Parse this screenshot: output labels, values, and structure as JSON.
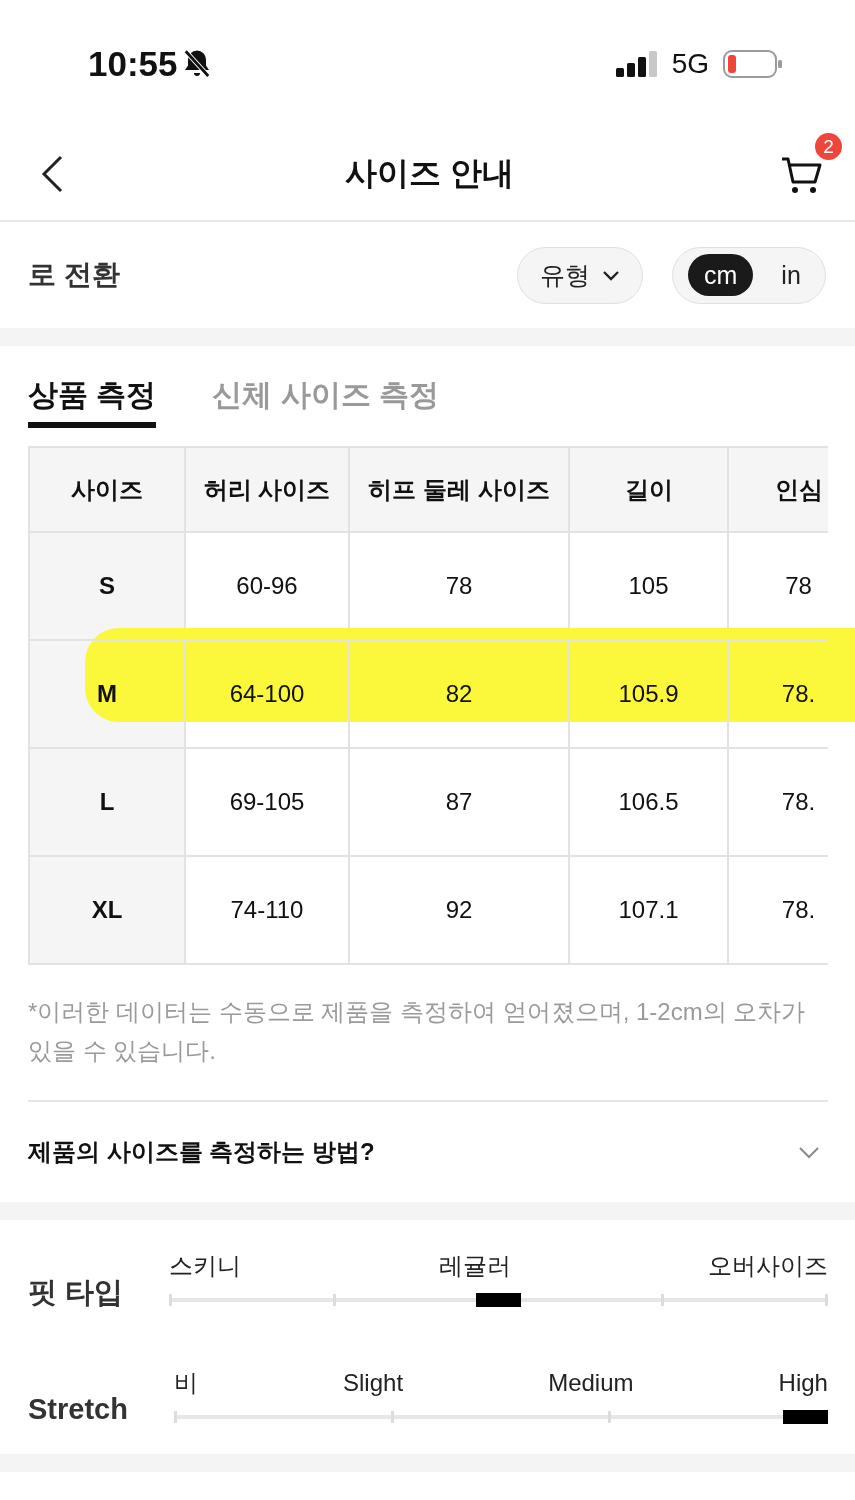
{
  "status_bar": {
    "time": "10:55",
    "network": "5G"
  },
  "header": {
    "title": "사이즈 안내",
    "cart_badge": "2"
  },
  "toolbar": {
    "label": "로 전환",
    "dropdown": {
      "label": "유형"
    },
    "units": [
      {
        "label": "cm",
        "selected": true
      },
      {
        "label": "in",
        "selected": false
      }
    ]
  },
  "tabs": [
    {
      "label": "상품 측정",
      "selected": true
    },
    {
      "label": "신체 사이즈 측정",
      "selected": false
    }
  ],
  "table": {
    "columns": [
      "사이즈",
      "허리 사이즈",
      "히프 둘레 사이즈",
      "길이",
      "인심"
    ],
    "rows": [
      {
        "cells": [
          "S",
          "60-96",
          "78",
          "105",
          "78"
        ],
        "highlighted": false
      },
      {
        "cells": [
          "M",
          "64-100",
          "82",
          "105.9",
          "78."
        ],
        "highlighted": true
      },
      {
        "cells": [
          "L",
          "69-105",
          "87",
          "106.5",
          "78."
        ],
        "highlighted": false
      },
      {
        "cells": [
          "XL",
          "74-110",
          "92",
          "107.1",
          "78."
        ],
        "highlighted": false
      }
    ]
  },
  "footnote": "*이러한 데이터는 수동으로 제품을 측정하여 얻어졌으며, 1-2cm의 오차가 있을 수 있습니다.",
  "accordion": {
    "title": "제품의 사이즈를 측정하는 방법?",
    "expanded": false
  },
  "fit_scales": [
    {
      "title": "핏 타입",
      "kind": "five_ticks",
      "labels": [
        "스키니",
        "레귤러",
        "오버사이즈"
      ],
      "level": 0.5
    },
    {
      "title": "Stretch",
      "kind": "four_ticks",
      "labels": [
        "비",
        "Slight",
        "Medium",
        "High"
      ],
      "level": 1
    }
  ]
}
